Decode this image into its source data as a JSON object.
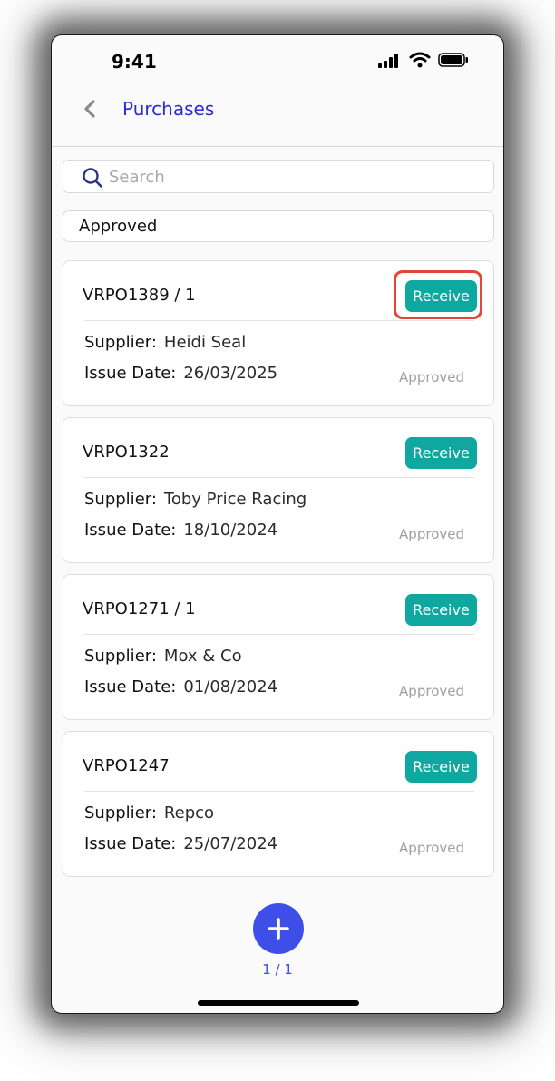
{
  "status_bar": {
    "time": "9:41",
    "icons": [
      "signal-icon",
      "wifi-icon",
      "battery-icon"
    ]
  },
  "nav": {
    "back_icon": "chevron-left-icon",
    "title": "Purchases"
  },
  "search": {
    "placeholder": "Search",
    "value": "",
    "icon": "search-icon"
  },
  "filter": {
    "selected": "Approved"
  },
  "purchases": [
    {
      "po_number": "VRPO1389 / 1",
      "receive_label": "Receive",
      "supplier_label": "Supplier:",
      "supplier": "Heidi Seal",
      "date_label": "Issue Date:",
      "issue_date": "26/03/2025",
      "status": "Approved"
    },
    {
      "po_number": "VRPO1322",
      "receive_label": "Receive",
      "supplier_label": "Supplier:",
      "supplier": "Toby Price Racing",
      "date_label": "Issue Date:",
      "issue_date": "18/10/2024",
      "status": "Approved"
    },
    {
      "po_number": "VRPO1271 / 1",
      "receive_label": "Receive",
      "supplier_label": "Supplier:",
      "supplier": "Mox & Co",
      "date_label": "Issue Date:",
      "issue_date": "01/08/2024",
      "status": "Approved"
    },
    {
      "po_number": "VRPO1247",
      "receive_label": "Receive",
      "supplier_label": "Supplier:",
      "supplier": "Repco",
      "date_label": "Issue Date:",
      "issue_date": "25/07/2024",
      "status": "Approved"
    }
  ],
  "footer": {
    "add_icon": "plus-icon",
    "page_indicator": "1 / 1"
  },
  "colors": {
    "accent": "#2b2bd6",
    "receive": "#0ea8a0",
    "fab": "#3d4fe8",
    "highlight": "#e0473a"
  }
}
